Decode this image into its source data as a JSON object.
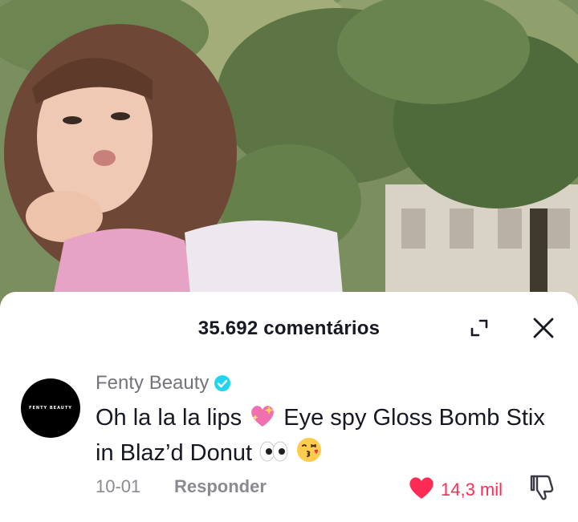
{
  "video": {
    "background": "outdoor-trees-video",
    "foliage_color": "#6f8656"
  },
  "sheet": {
    "comment_count_label": "35.692 comentários",
    "icons": {
      "expand": "expand-icon",
      "close": "close-icon"
    }
  },
  "comment": {
    "avatar_text": "FENTY BEAUTY",
    "author": "Fenty Beauty",
    "verified": true,
    "text_part1": "Oh la la la lips",
    "emoji1": "sparkling-heart-emoji",
    "text_part2": "Eye spy Gloss Bomb Stix in Blaz’d Donut",
    "emoji2": "eyes-emoji",
    "emoji3": "kissing-face-emoji",
    "date": "10-01",
    "reply_label": "Responder",
    "like_count": "14,3 mil",
    "liked": true
  },
  "colors": {
    "like_red": "#fe2c55",
    "verified_blue": "#20d5ec",
    "text_primary": "#161823",
    "text_secondary": "#8a8b91"
  }
}
